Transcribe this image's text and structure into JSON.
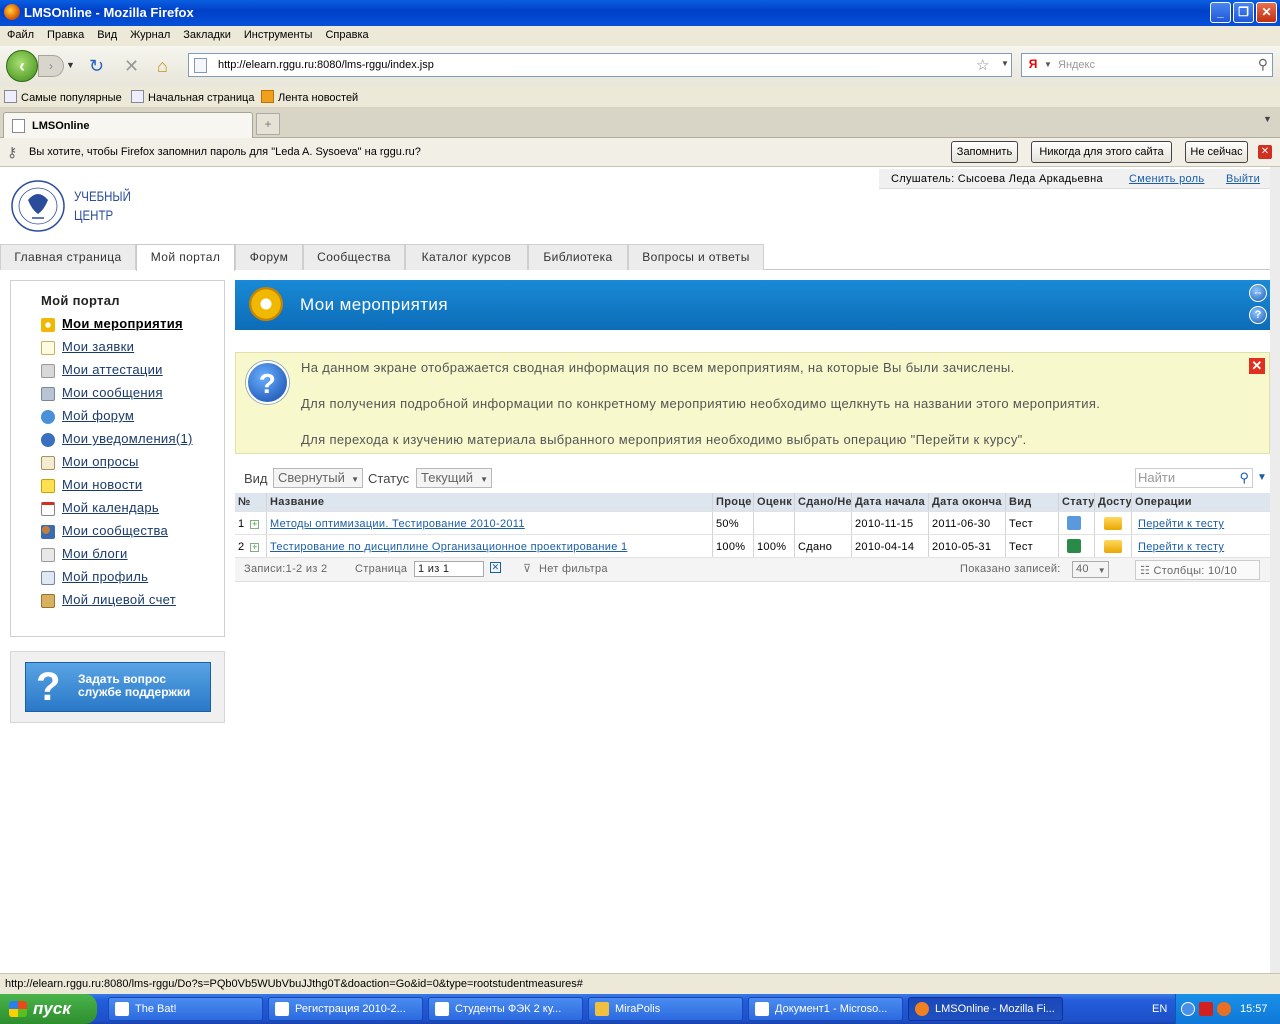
{
  "window": {
    "title": "LMSOnline - Mozilla Firefox"
  },
  "menubar": [
    "Файл",
    "Правка",
    "Вид",
    "Журнал",
    "Закладки",
    "Инструменты",
    "Справка"
  ],
  "navbar": {
    "url": "http://elearn.rggu.ru:8080/lms-rggu/index.jsp",
    "search_placeholder": "Яндекс",
    "search_engine_letter": "Я"
  },
  "bookmarks": [
    "Самые популярные",
    "Начальная страница",
    "Лента новостей"
  ],
  "tabs": {
    "active": "LMSOnline",
    "new_tab_symbol": "+"
  },
  "password_bar": {
    "message": "Вы хотите, чтобы Firefox запомнил пароль для \"Leda A. Sysoeva\" на rggu.ru?",
    "remember": "Запомнить",
    "never": "Никогда для этого сайта",
    "not_now": "Не сейчас"
  },
  "user": {
    "label": "Слушатель: Сысоева Леда Аркадьевна",
    "switch_role": "Сменить роль",
    "logout": "Выйти"
  },
  "logo": {
    "line1": "УЧЕБНЫЙ",
    "line2": "ЦЕНТР"
  },
  "nav_tabs": [
    "Главная страница",
    "Мой портал",
    "Форум",
    "Сообщества",
    "Каталог курсов",
    "Библиотека",
    "Вопросы и ответы"
  ],
  "sidebar": {
    "title": "Мой портал",
    "items": [
      "Мои мероприятия",
      "Мои заявки",
      "Мои аттестации",
      "Мои сообщения",
      "Мой форум",
      "Мои уведомления(1)",
      "Мои опросы",
      "Мои новости",
      "Мой календарь",
      "Мои сообщества",
      "Мои блоги",
      "Мой профиль",
      "Мой лицевой счет"
    ],
    "support_line1": "Задать вопрос",
    "support_line2": "службе поддержки"
  },
  "header": {
    "title": "Мои мероприятия"
  },
  "info": {
    "line1": "На данном экране отображается сводная информация по всем мероприятиям, на которые Вы были зачислены.",
    "line2": "Для получения подробной информации по конкретному мероприятию необходимо щелкнуть на названии этого мероприятия.",
    "line3": "Для перехода к изучению материала выбранного мероприятия необходимо выбрать операцию \"Перейти к курсу\"."
  },
  "filters": {
    "view_label": "Вид",
    "view_value": "Свернутый",
    "status_label": "Статус",
    "status_value": "Текущий",
    "find_placeholder": "Найти"
  },
  "table": {
    "headers": [
      "№",
      "Название",
      "Проце",
      "Оценк",
      "Сдано/Не",
      "Дата начала",
      "Дата оконча",
      "Вид",
      "Статус",
      "Досту",
      "Операции"
    ],
    "rows": [
      {
        "num": "1",
        "name": "Методы оптимизации. Тестирование 2010-2011",
        "percent": "50%",
        "grade": "",
        "passed": "",
        "start": "2010-11-15",
        "end": "2011-06-30",
        "kind": "Тест",
        "op": "Перейти к тесту"
      },
      {
        "num": "2",
        "name": "Тестирование по дисциплине Организационное проектирование 1",
        "percent": "100%",
        "grade": "100%",
        "passed": "Сдано",
        "start": "2010-04-14",
        "end": "2010-05-31",
        "kind": "Тест",
        "op": "Перейти к тесту"
      }
    ]
  },
  "footer": {
    "records": "Записи:1-2 из 2",
    "page_label": "Страница",
    "page_value": "1 из 1",
    "no_filter": "Нет фильтра",
    "shown_label": "Показано записей:",
    "shown_value": "40",
    "columns": "Столбцы: 10/10"
  },
  "statusbar": "http://elearn.rggu.ru:8080/lms-rggu/Do?s=PQb0Vb5WUbVbuJJthg0T&doaction=Go&id=0&type=rootstudentmeasures#",
  "taskbar": {
    "start": "пуск",
    "items": [
      "The Bat!",
      "Регистрация 2010-2...",
      "Студенты ФЭК 2 ку...",
      "MiraPolis",
      "Документ1 - Microso...",
      "LMSOnline - Mozilla Fi..."
    ],
    "lang": "EN",
    "clock": "15:57"
  }
}
